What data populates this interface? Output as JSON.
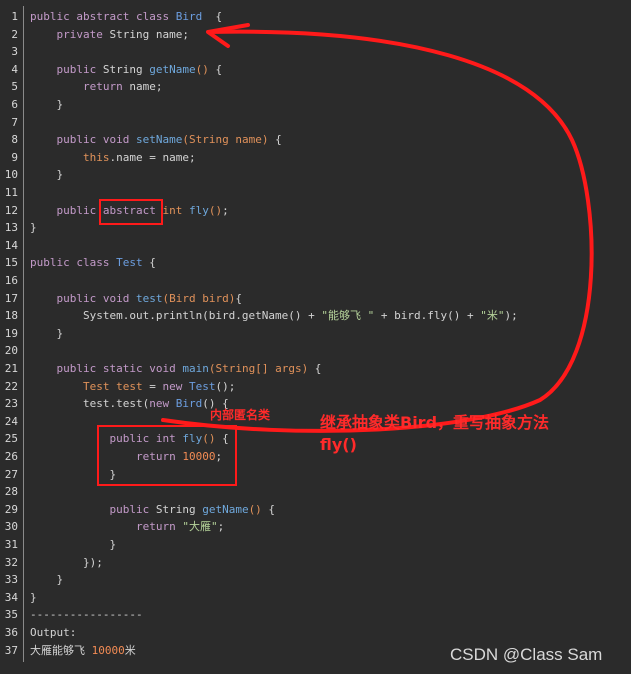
{
  "code_lines": [
    [
      [
        "k",
        "public abstract class "
      ],
      [
        "t",
        "Bird"
      ],
      [
        "",
        "  {"
      ]
    ],
    [
      [
        "",
        "    "
      ],
      [
        "k",
        "private "
      ],
      [
        "",
        "String name;"
      ]
    ],
    [],
    [
      [
        "",
        "    "
      ],
      [
        "k",
        "public "
      ],
      [
        "",
        "String "
      ],
      [
        "f",
        "getName"
      ],
      [
        "p",
        "()"
      ],
      [
        "",
        " {"
      ]
    ],
    [
      [
        "",
        "        "
      ],
      [
        "k",
        "return "
      ],
      [
        "",
        "name;"
      ]
    ],
    [
      [
        "",
        "    }"
      ]
    ],
    [],
    [
      [
        "",
        "    "
      ],
      [
        "k",
        "public void "
      ],
      [
        "f",
        "setName"
      ],
      [
        "p",
        "("
      ],
      [
        "a",
        "String name"
      ],
      [
        "p",
        ")"
      ],
      [
        "",
        " {"
      ]
    ],
    [
      [
        "",
        "        "
      ],
      [
        "o",
        "this"
      ],
      [
        "",
        ".name = name;"
      ]
    ],
    [
      [
        "",
        "    }"
      ]
    ],
    [],
    [
      [
        "",
        "    "
      ],
      [
        "k",
        "public abstract "
      ],
      [
        "o",
        "int "
      ],
      [
        "f",
        "fly"
      ],
      [
        "p",
        "()"
      ],
      [
        "",
        ";"
      ]
    ],
    [
      [
        "",
        "}"
      ]
    ],
    [],
    [
      [
        "k",
        "public class "
      ],
      [
        "t",
        "Test"
      ],
      [
        "",
        " {"
      ]
    ],
    [],
    [
      [
        "",
        "    "
      ],
      [
        "k",
        "public void "
      ],
      [
        "f",
        "test"
      ],
      [
        "p",
        "("
      ],
      [
        "a",
        "Bird bird"
      ],
      [
        "p",
        ")"
      ],
      [
        "",
        "{"
      ]
    ],
    [
      [
        "",
        "        System.out.println(bird.getName() + "
      ],
      [
        "s",
        "\"能够飞 \""
      ],
      [
        "",
        " + bird.fly() + "
      ],
      [
        "s",
        "\"米\""
      ],
      [
        "",
        ");"
      ]
    ],
    [
      [
        "",
        "    }"
      ]
    ],
    [],
    [
      [
        "",
        "    "
      ],
      [
        "k",
        "public static void "
      ],
      [
        "f",
        "main"
      ],
      [
        "p",
        "("
      ],
      [
        "a",
        "String[] args"
      ],
      [
        "p",
        ")"
      ],
      [
        "",
        " {"
      ]
    ],
    [
      [
        "",
        "        "
      ],
      [
        "o",
        "Test test"
      ],
      [
        "",
        " = "
      ],
      [
        "k",
        "new "
      ],
      [
        "t",
        "Test"
      ],
      [
        "",
        "();"
      ]
    ],
    [
      [
        "",
        "        test.test("
      ],
      [
        "k",
        "new "
      ],
      [
        "t",
        "Bird"
      ],
      [
        "",
        "() {"
      ]
    ],
    [],
    [
      [
        "",
        "            "
      ],
      [
        "k",
        "public int "
      ],
      [
        "f",
        "fly"
      ],
      [
        "p",
        "()"
      ],
      [
        "",
        " {"
      ]
    ],
    [
      [
        "",
        "                "
      ],
      [
        "k",
        "return "
      ],
      [
        "n",
        "10000"
      ],
      [
        "",
        ";"
      ]
    ],
    [
      [
        "",
        "            }"
      ]
    ],
    [],
    [
      [
        "",
        "            "
      ],
      [
        "k",
        "public "
      ],
      [
        "",
        "String "
      ],
      [
        "f",
        "getName"
      ],
      [
        "p",
        "()"
      ],
      [
        "",
        " {"
      ]
    ],
    [
      [
        "",
        "                "
      ],
      [
        "k",
        "return "
      ],
      [
        "s",
        "\"大雁\""
      ],
      [
        "",
        ";"
      ]
    ],
    [
      [
        "",
        "            }"
      ]
    ],
    [
      [
        "",
        "        });"
      ]
    ],
    [
      [
        "",
        "    }"
      ]
    ],
    [
      [
        "",
        "}"
      ]
    ],
    [
      [
        "",
        "-----------------"
      ]
    ],
    [
      [
        "",
        "Output:"
      ]
    ],
    [
      [
        "",
        "大雁能够飞 "
      ],
      [
        "n",
        "10000"
      ],
      [
        "",
        "米"
      ]
    ]
  ],
  "annotations": {
    "anonymous_class_label": "内部匿名类",
    "explanation": "继承抽象类Bird，重写抽象方法fly()",
    "color": "#ff1a1a"
  },
  "watermark": "CSDN @Class Sam",
  "colors": {
    "background": "#2b2b2b",
    "keyword": "#c39ac9",
    "type": "#6c9ee0",
    "string": "#b5d39a",
    "number": "#f28b54"
  }
}
